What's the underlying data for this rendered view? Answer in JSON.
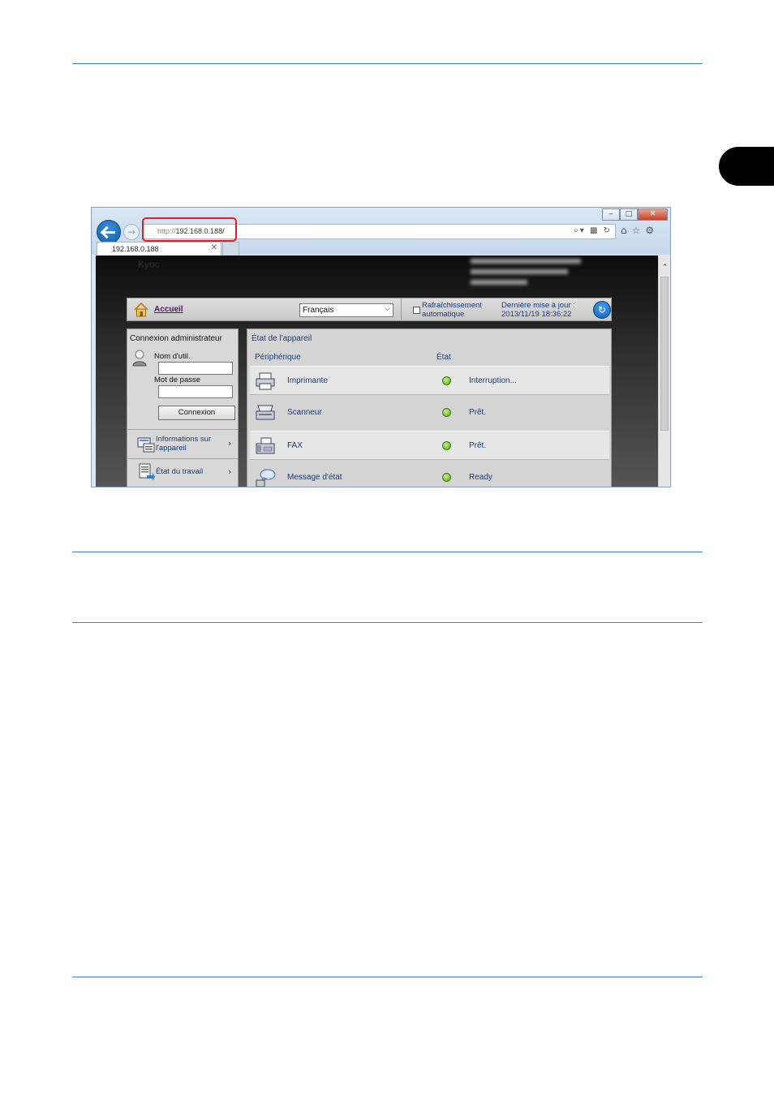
{
  "browser": {
    "url_prefix": "http://",
    "url": "192.168.0.188/",
    "tab_title": "192.168.0.188",
    "window_controls": [
      "minimize",
      "maximize",
      "close"
    ]
  },
  "header": {
    "logo_text": "Kyoc"
  },
  "menubar": {
    "home_label": "Accueil",
    "language": "Français",
    "refresh_line1": "Rafraîchissement",
    "refresh_line2": "automatique",
    "last_update_line1": "Dernière mise à jour :",
    "last_update_line2": "2013/11/19 18:36:22"
  },
  "login": {
    "title": "Connexion administrateur",
    "username_label": "Nom d'util.",
    "password_label": "Mot de passe",
    "username_value": "",
    "password_value": "",
    "submit_label": "Connexion"
  },
  "left_nav": [
    {
      "line1": "Informations sur",
      "line2": "l'appareil"
    },
    {
      "line1": "État du travail",
      "line2": ""
    }
  ],
  "device_status": {
    "title": "État de l'appareil",
    "col_device": "Périphérique",
    "col_state": "État",
    "rows": [
      {
        "name": "Imprimante",
        "status": "Interruption...",
        "icon": "printer-icon",
        "status_color": "#6cc227"
      },
      {
        "name": "Scanneur",
        "status": "Prêt.",
        "icon": "scanner-icon",
        "status_color": "#6cc227"
      },
      {
        "name": "FAX",
        "status": "Prêt.",
        "icon": "fax-icon",
        "status_color": "#6cc227"
      },
      {
        "name": "Message d'état",
        "status": "Ready",
        "icon": "message-icon",
        "status_color": "#6cc227"
      }
    ]
  },
  "colors": {
    "rule": "#3f7fc6",
    "highlight": "#e02020",
    "link": "#1a3e7c"
  }
}
